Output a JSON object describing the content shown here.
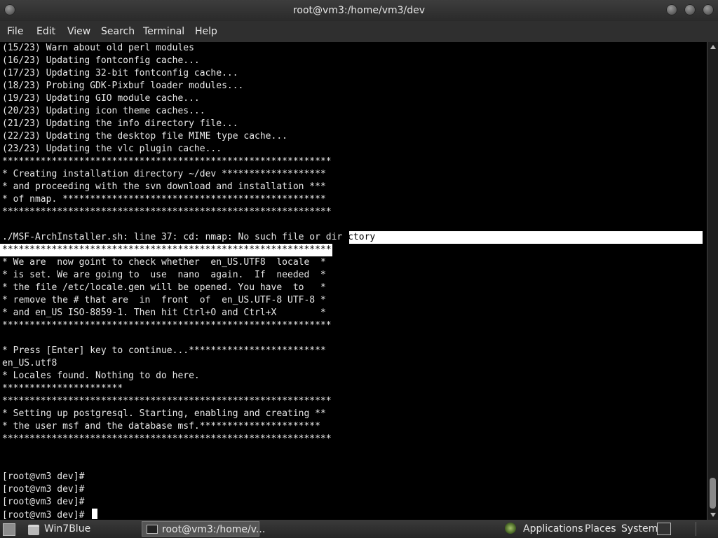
{
  "window": {
    "title": "root@vm3:/home/vm3/dev"
  },
  "menu": {
    "items": [
      "File",
      "Edit",
      "View",
      "Search",
      "Terminal",
      "Help"
    ]
  },
  "terminal": {
    "lines": [
      "(15/23) Warn about old perl modules",
      "(16/23) Updating fontconfig cache...",
      "(17/23) Updating 32-bit fontconfig cache...",
      "(18/23) Probing GDK-Pixbuf loader modules...",
      "(19/23) Updating GIO module cache...",
      "(20/23) Updating icon theme caches...",
      "(21/23) Updating the info directory file...",
      "(22/23) Updating the desktop file MIME type cache...",
      "(23/23) Updating the vlc plugin cache...",
      "************************************************************",
      "* Creating installation directory ~/dev *******************",
      "* and proceeding with the svn download and installation ***",
      "* of nmap. ************************************************",
      "************************************************************",
      "",
      "./MSF-ArchInstaller.sh: line 37: cd: nmap: No such file or directory",
      "************************************************************",
      "* We are  now goint to check whether  en_US.UTF8  locale  *",
      "* is set. We are going to  use  nano  again.  If  needed  *",
      "* the file /etc/locale.gen will be opened. You have  to   *",
      "* remove the # that are  in  front  of  en_US.UTF-8 UTF-8 *",
      "* and en_US ISO-8859-1. Then hit Ctrl+O and Ctrl+X        *",
      "************************************************************",
      "",
      "* Press [Enter] key to continue...*************************",
      "en_US.utf8",
      "* Locales found. Nothing to do here.",
      "**********************",
      "************************************************************",
      "* Setting up postgresql. Starting, enabling and creating **",
      "* the user msf and the database msf.**********************",
      "************************************************************",
      "",
      "",
      "[root@vm3 dev]#",
      "[root@vm3 dev]#",
      "[root@vm3 dev]#",
      "[root@vm3 dev]# "
    ]
  },
  "taskbar": {
    "tasks": [
      "Win7Blue",
      "root@vm3:/home/v..."
    ],
    "applications": "Applications",
    "places": "Places",
    "system": "System"
  },
  "colors": {
    "terminal_bg": "#000000",
    "terminal_fg": "#e8e8e8",
    "selection": "#ffffff"
  }
}
